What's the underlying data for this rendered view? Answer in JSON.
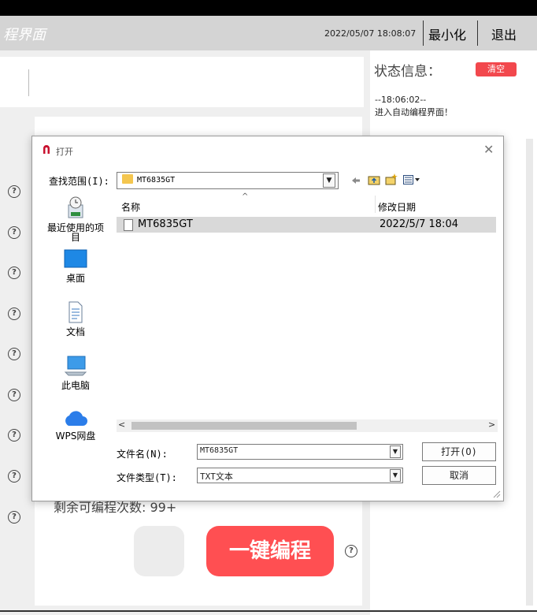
{
  "header": {
    "app_title": "程界面",
    "datetime": "2022/05/07  18:08:07",
    "minimize_label": "最小化",
    "exit_label": "退出"
  },
  "status": {
    "label": "状态信息：",
    "clear_label": "清空",
    "log_time": "--18:06:02--",
    "log_message": "进入自动编程界面！"
  },
  "main": {
    "remaining_text": "剩余可编程次数: 99+",
    "one_key_label": "一键编程",
    "help_glyph": "?"
  },
  "dialog": {
    "title": "打开",
    "close_glyph": "✕",
    "look_in_label": "查找范围(I):",
    "look_in_value": "MT6835GT",
    "places": [
      {
        "label": "最近使用的项目",
        "icon": "recent-icon"
      },
      {
        "label": "桌面",
        "icon": "desktop-icon"
      },
      {
        "label": "文档",
        "icon": "documents-icon"
      },
      {
        "label": "此电脑",
        "icon": "computer-icon"
      },
      {
        "label": "WPS网盘",
        "icon": "cloud-icon"
      }
    ],
    "columns": {
      "name": "名称",
      "date": "修改日期"
    },
    "files": [
      {
        "name": "MT6835GT",
        "date": "2022/5/7 18:04"
      }
    ],
    "file_name_label": "文件名(N):",
    "file_name_value": "MT6835GT",
    "file_type_label": "文件类型(T):",
    "file_type_value": "TXT文本",
    "open_label": "打开(O)",
    "cancel_label": "取消"
  },
  "colors": {
    "accent_red": "#ff4f52",
    "clear_red": "#f2484d",
    "titlebar": "#d4d4d4"
  }
}
